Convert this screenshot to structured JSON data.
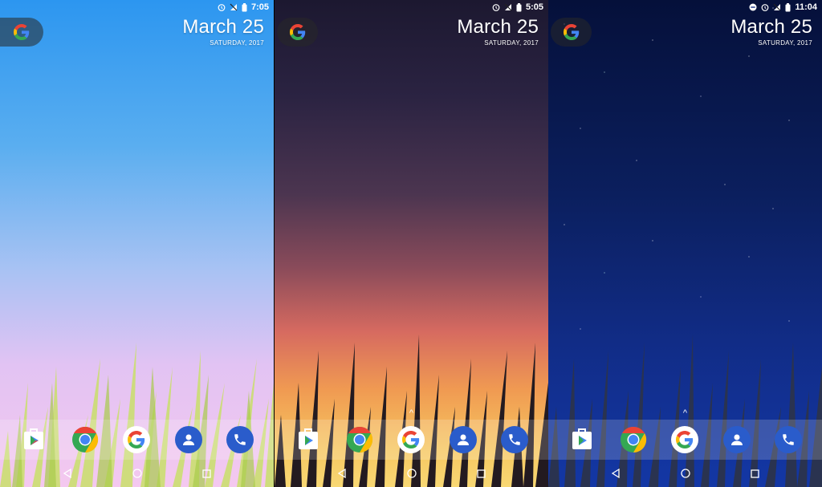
{
  "screens": [
    {
      "status": {
        "time": "7:05"
      },
      "date": {
        "big": "March 25",
        "small": "SATURDAY, 2017"
      }
    },
    {
      "status": {
        "time": "5:05"
      },
      "date": {
        "big": "March 25",
        "small": "SATURDAY, 2017"
      }
    },
    {
      "status": {
        "time": "11:04"
      },
      "date": {
        "big": "March 25",
        "small": "SATURDAY, 2017"
      }
    }
  ],
  "dock_apps": [
    "play-store-icon",
    "chrome-icon",
    "google-icon",
    "contacts-icon",
    "phone-icon"
  ],
  "nav": [
    "back-icon",
    "home-icon",
    "recents-icon"
  ],
  "colors": {
    "google_blue": "#4285F4",
    "google_red": "#EA4335",
    "google_yellow": "#FBBC05",
    "google_green": "#34A853",
    "app_blue": "#2A5CCB"
  }
}
